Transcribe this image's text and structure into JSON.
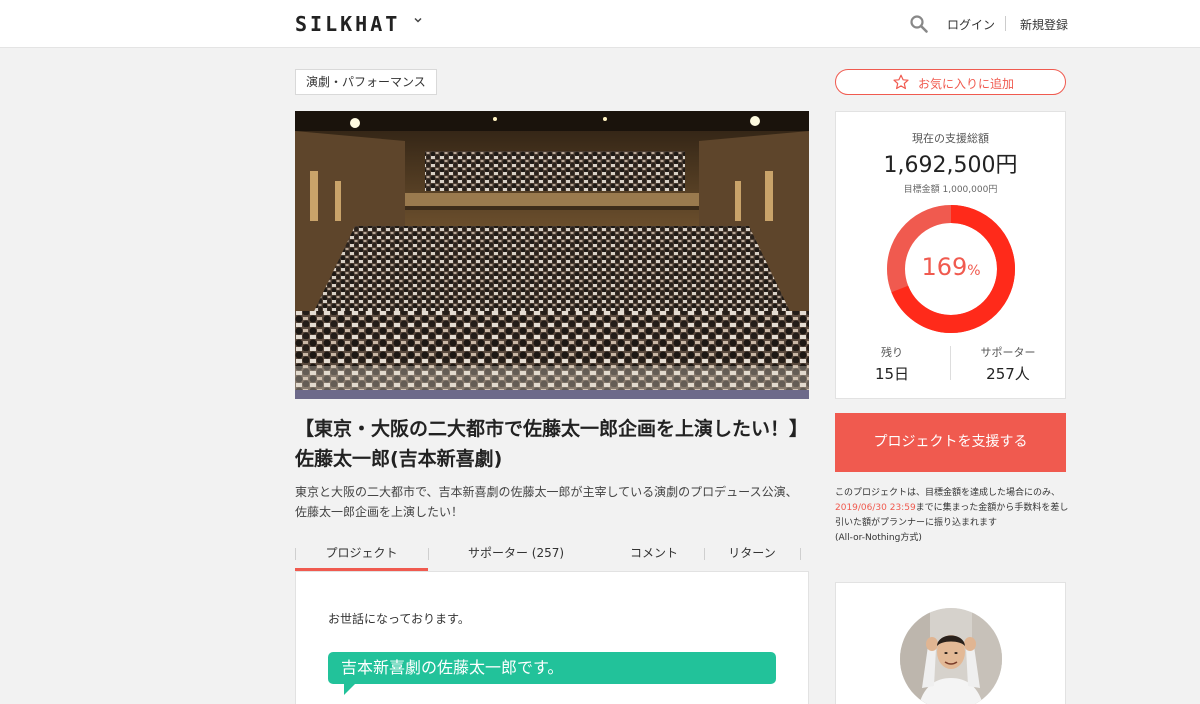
{
  "header": {
    "logo": "SILKHAT",
    "login": "ログイン",
    "signup": "新規登録"
  },
  "project": {
    "category": "演劇・パフォーマンス",
    "title_line1": "【東京・大阪の二大都市で佐藤太一郎企画を上演したい！】",
    "title_line2": "佐藤太一郎(吉本新喜劇)",
    "summary_line1": "東京と大阪の二大都市で、吉本新喜劇の佐藤太一郎が主宰している演劇のプロデュース公演、",
    "summary_line2": "佐藤太一郎企画を上演したい！"
  },
  "tabs": [
    {
      "label": "プロジェクト",
      "active": true
    },
    {
      "label": "サポーター (257)",
      "active": false
    },
    {
      "label": "コメント",
      "active": false
    },
    {
      "label": "リターン",
      "active": false
    }
  ],
  "content": {
    "greeting": "お世話になっております。",
    "bubble": "吉本新喜劇の佐藤太一郎です。"
  },
  "sidebar": {
    "favorite": "お気に入りに追加",
    "current_label": "現在の支援総額",
    "current_amount": "1,692,500円",
    "goal": "目標金額 1,000,000円",
    "progress_percent": 169,
    "percent_number": "169",
    "percent_sign": "%",
    "remaining_label": "残り",
    "remaining_value": "15日",
    "supporters_label": "サポーター",
    "supporters_value": "257人",
    "support_button": "プロジェクトを支援する",
    "note_before": "このプロジェクトは、目標金額を達成した場合にのみ、",
    "note_date": "2019/06/30 23:59",
    "note_after": "までに集まった金額から手数料を差し引いた額がプランナーに振り込まれます",
    "note_type": "(All-or-Nothing方式)"
  },
  "colors": {
    "accent": "#f05a4f",
    "bubble": "#22c29a"
  }
}
